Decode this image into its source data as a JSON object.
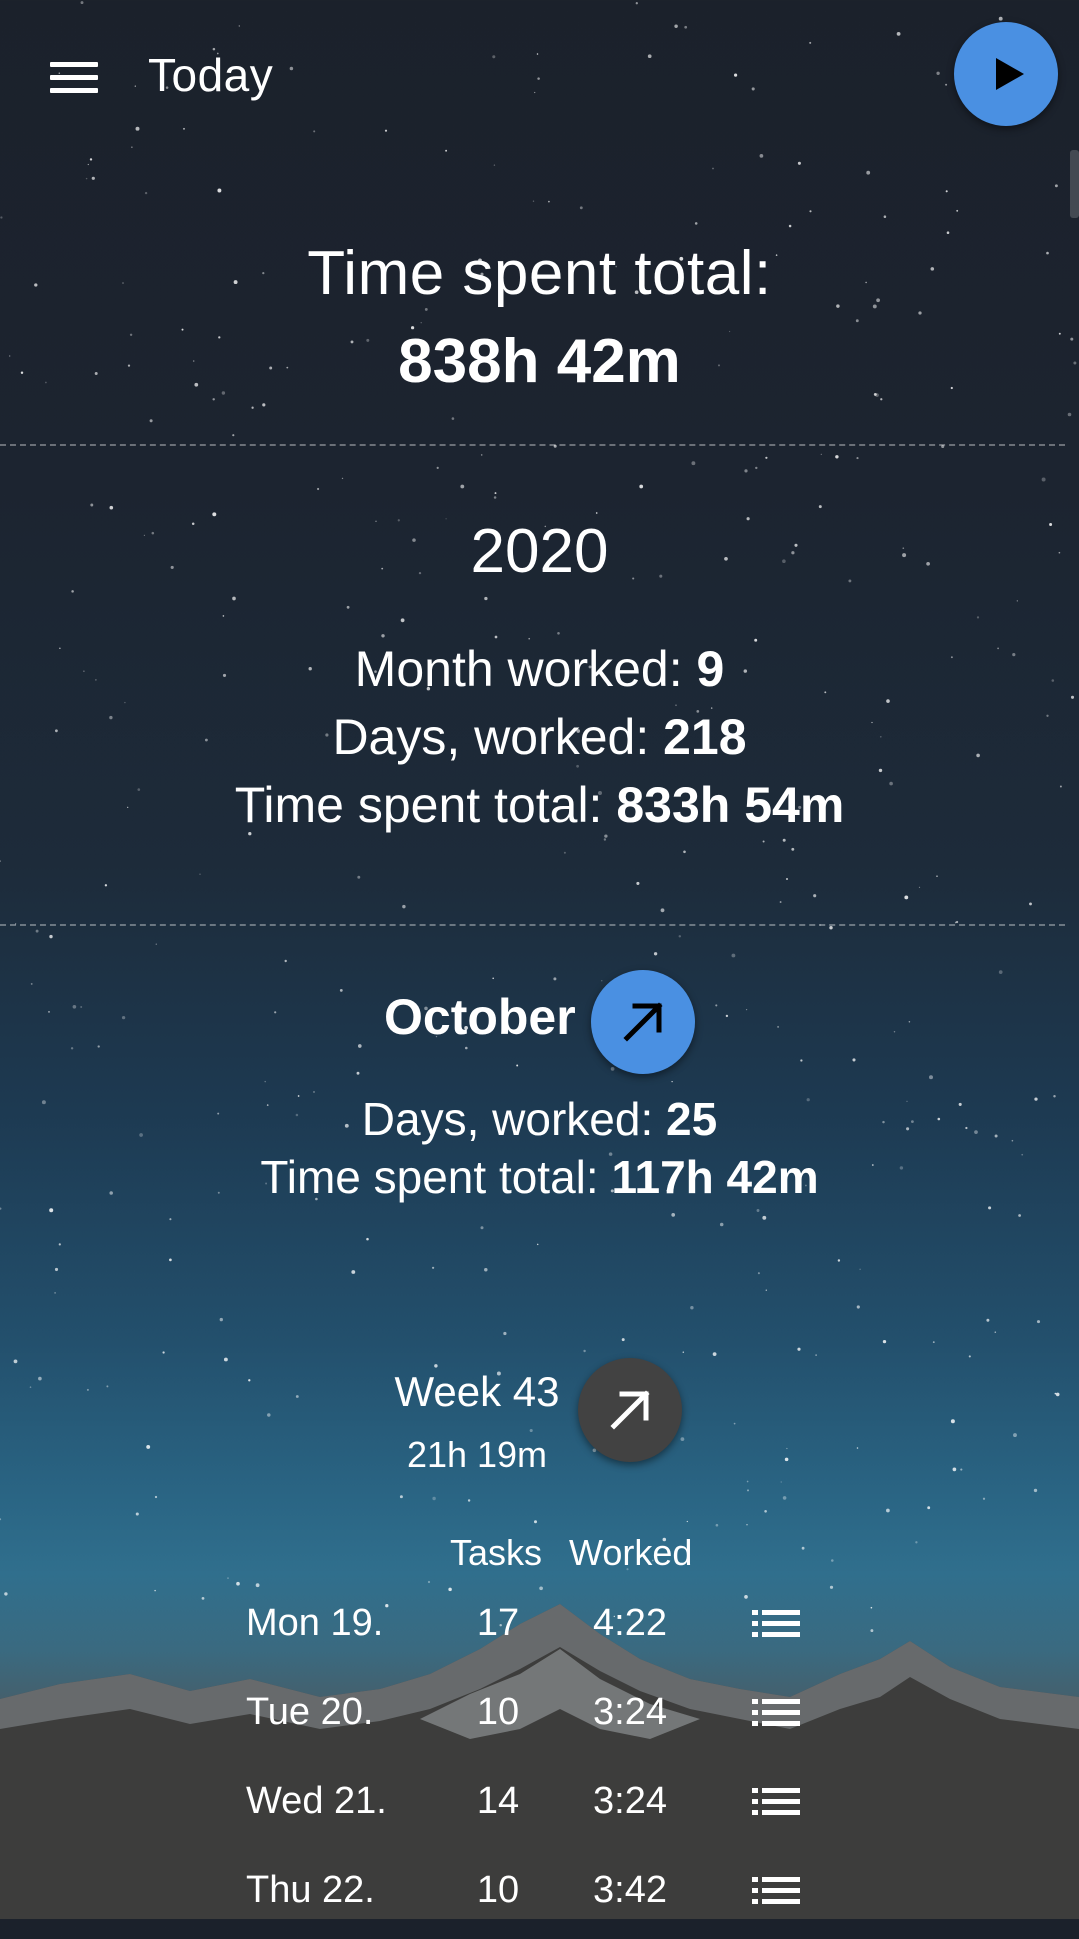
{
  "header": {
    "title": "Today",
    "menu_icon": "menu-icon",
    "play_icon": "play-icon",
    "accent_color": "#4a90e2"
  },
  "summary": {
    "label": "Time spent total:",
    "value": "838h 42m"
  },
  "year": {
    "label": "2020",
    "month_worked_label": "Month worked:",
    "month_worked_value": "9",
    "days_worked_label": "Days, worked:",
    "days_worked_value": "218",
    "time_label": "Time spent total:",
    "time_value": "833h 54m"
  },
  "month": {
    "name": "October",
    "open_icon": "arrow-up-right-icon",
    "days_worked_label": "Days, worked:",
    "days_worked_value": "25",
    "time_label": "Time spent total:",
    "time_value": "117h 42m"
  },
  "week": {
    "title": "Week 43",
    "total": "21h 19m",
    "open_icon": "arrow-up-right-icon",
    "columns": {
      "tasks": "Tasks",
      "worked": "Worked"
    },
    "rows": [
      {
        "day": "Mon 19.",
        "tasks": "17",
        "worked": "4:22",
        "icon": "list-icon"
      },
      {
        "day": "Tue 20.",
        "tasks": "10",
        "worked": "3:24",
        "icon": "list-icon"
      },
      {
        "day": "Wed 21.",
        "tasks": "14",
        "worked": "3:24",
        "icon": "list-icon"
      },
      {
        "day": "Thu 22.",
        "tasks": "10",
        "worked": "3:42",
        "icon": "list-icon"
      }
    ]
  }
}
